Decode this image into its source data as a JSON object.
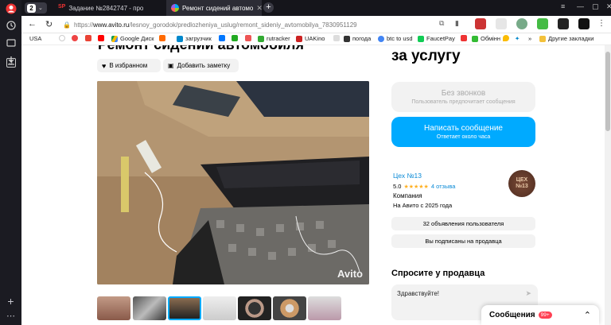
{
  "tabs": [
    {
      "label": "",
      "favicon": "sidebar-profile"
    },
    {
      "label": "Задание №2842747 - про",
      "favicon": "SP"
    },
    {
      "label": "Ремонт сидений автомо",
      "favicon": "avito"
    }
  ],
  "tab_counter": "2",
  "address": {
    "protocol": "https://",
    "host": "www.avito.ru",
    "path": "/lesnoy_gorodok/predlozheniya_uslug/remont_sideniy_avtomobilya_7830951129"
  },
  "bookmarks": [
    "USA",
    "Google Диск",
    "загрузчик",
    "rutracker",
    "UAKino",
    "погода",
    "btc to usd",
    "FaucetPay",
    "Обмінн"
  ],
  "bookmarks_other": "Другие закладки",
  "listing": {
    "title_partial": "Ремонт сидений автомобиля",
    "price_partial": "за услугу",
    "favorite_label": "В избранном",
    "note_label": "Добавить заметку",
    "watermark": "Avito"
  },
  "contact": {
    "no_calls_title": "Без звонков",
    "no_calls_sub": "Пользователь предпочитает сообщения",
    "write_title": "Написать сообщение",
    "write_sub": "Ответает около часа"
  },
  "seller": {
    "name": "Цех №13",
    "rating": "5.0",
    "stars": "★★★★★",
    "reviews": "4 отзыва",
    "type": "Компания",
    "since": "На Авито с 2025 года",
    "avatar_text": "ЦЕХ\n№13",
    "listings_btn": "32 объявления пользователя",
    "subscribed_btn": "Вы подписаны на продавца"
  },
  "ask": {
    "heading": "Спросите у продавца",
    "placeholder": "Здравствуйте!"
  },
  "messages_bar": {
    "label": "Сообщения",
    "badge": "99+"
  },
  "colors": {
    "accent_blue": "#00aaff",
    "grey_button": "#f2f2f2",
    "star": "#ffb021"
  }
}
